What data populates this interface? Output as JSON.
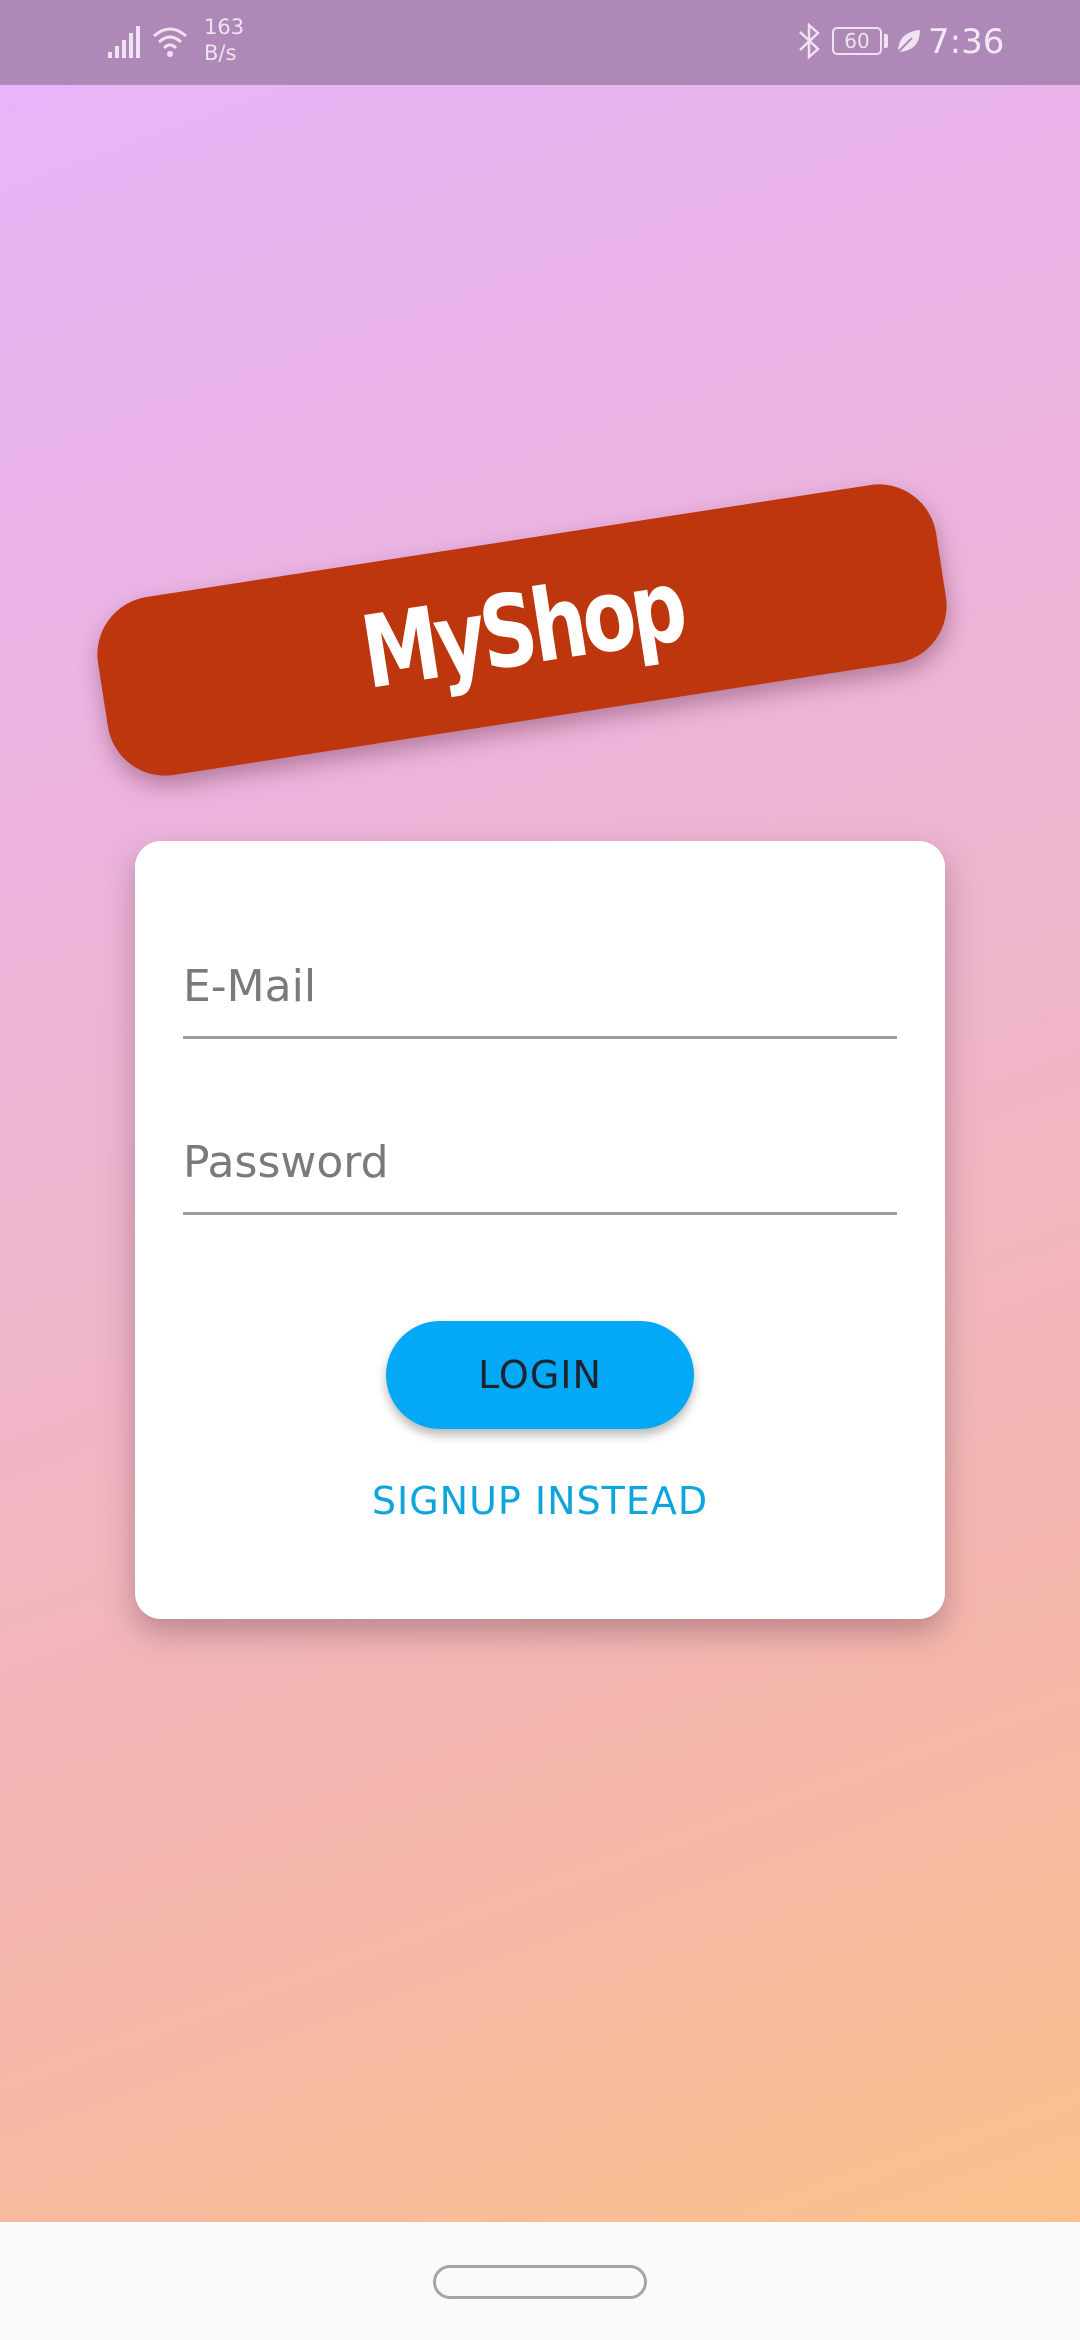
{
  "status_bar": {
    "net_speed_value": "163",
    "net_speed_unit": "B/s",
    "battery_level": "60",
    "time": "7:36",
    "icons": [
      "signal-icon",
      "wifi-icon",
      "bluetooth-icon",
      "battery-icon",
      "leaf-icon"
    ]
  },
  "logo": {
    "text": "MyShop",
    "color": "#bd360e"
  },
  "auth_form": {
    "email_placeholder": "E-Mail",
    "password_placeholder": "Password",
    "login_label": "LOGIN",
    "signup_label": "SIGNUP INSTEAD",
    "accent_color": "#03a9f4"
  }
}
